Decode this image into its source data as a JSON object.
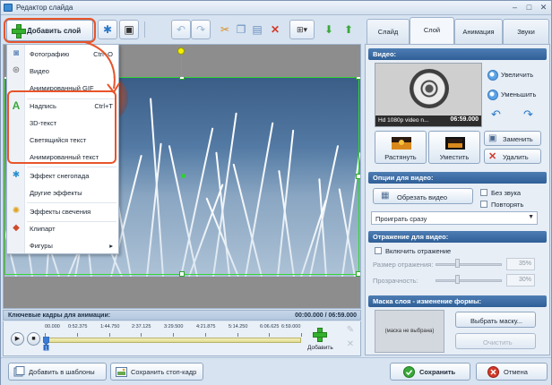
{
  "window": {
    "title": "Редактор слайда",
    "controls": [
      "–",
      "□",
      "✕"
    ]
  },
  "toolbar": {
    "add_layer_label": "Добавить слой"
  },
  "menu": {
    "items": [
      {
        "label": "Фотографию",
        "shortcut": "Ctrl+O",
        "icon": "photo-icon"
      },
      {
        "label": "Видео",
        "shortcut": "",
        "icon": "video-icon"
      },
      {
        "label": "Анимированный GIF",
        "shortcut": "",
        "icon": ""
      },
      {
        "label": "Надпись",
        "shortcut": "Ctrl+T",
        "icon": "text-icon"
      },
      {
        "label": "3D-текст",
        "shortcut": "",
        "icon": ""
      },
      {
        "label": "Светящийся текст",
        "shortcut": "",
        "icon": ""
      },
      {
        "label": "Анимированный текст",
        "shortcut": "",
        "icon": ""
      },
      {
        "label": "Эффект снегопада",
        "shortcut": "",
        "icon": "snowflake-icon"
      },
      {
        "label": "Другие эффекты",
        "shortcut": "",
        "icon": ""
      },
      {
        "label": "Эффекты свечения",
        "shortcut": "",
        "icon": "glow-icon"
      },
      {
        "label": "Клипарт",
        "shortcut": "",
        "icon": "clipart-icon"
      },
      {
        "label": "Фигуры",
        "shortcut": "▸",
        "icon": ""
      }
    ]
  },
  "keyframes": {
    "title": "Ключевые кадры для анимации:",
    "time": "00:00.000 / 06:59.000",
    "ticks": [
      "00.000",
      "0:52.375",
      "1:44.750",
      "2:37.125",
      "3:29.500",
      "4:21.875",
      "5:14.250",
      "6:06.625",
      "6:59.000"
    ],
    "marker_label": "1",
    "add_label": "Добавить"
  },
  "bottom": {
    "add_templates": "Добавить в шаблоны",
    "save_frame": "Сохранить стоп-кадр",
    "save": "Сохранить",
    "cancel": "Отмена"
  },
  "panel": {
    "tabs": [
      "Слайд",
      "Слой",
      "Анимация",
      "Звуки"
    ],
    "active_tab": "Слой",
    "video_section": "Видео:",
    "thumb_name": "Hd 1080p video n...",
    "thumb_duration": "06:59.000",
    "zoom_in": "Увеличить",
    "zoom_out": "Уменьшить",
    "stretch": "Растянуть",
    "fit": "Уместить",
    "replace": "Заменить",
    "delete": "Удалить",
    "options_section": "Опции для видео:",
    "trim_video": "Обрезать видео",
    "no_sound": "Без звука",
    "repeat": "Повторять",
    "play_mode": "Проиграть сразу",
    "reflection_section": "Отражение для видео:",
    "enable_reflection": "Включить отражение",
    "reflection_size_label": "Размер отражения:",
    "reflection_size_value": "35%",
    "transparency_label": "Прозрачность:",
    "transparency_value": "30%",
    "mask_section": "Маска слоя - изменение формы:",
    "mask_placeholder": "(маска не выбрана)",
    "choose_mask": "Выбрать маску...",
    "clear": "Очистить"
  },
  "colors": {
    "highlight": "#e8542a",
    "section_header": "#3a6aa3",
    "selection": "#35d335"
  }
}
